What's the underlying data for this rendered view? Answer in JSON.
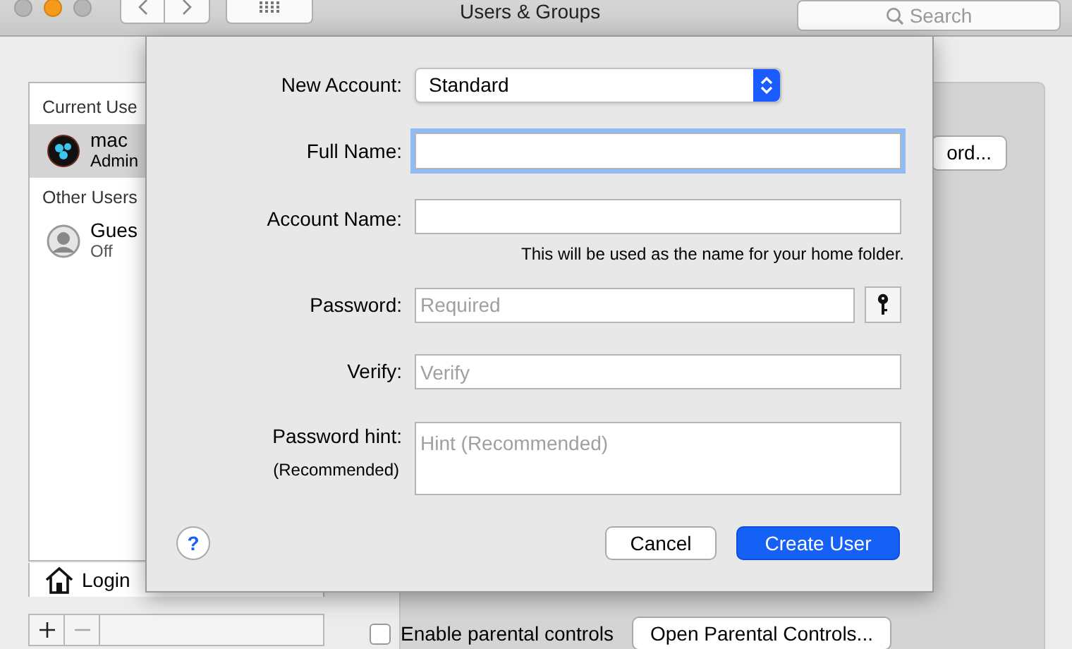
{
  "window": {
    "title": "Users & Groups",
    "search": {
      "placeholder": "Search"
    }
  },
  "sidebar": {
    "sections": [
      {
        "header": "Current Use",
        "users": [
          {
            "name": "mac",
            "role": "Admin",
            "selected": true,
            "kind": "admin"
          }
        ]
      },
      {
        "header": "Other Users",
        "users": [
          {
            "name": "Gues",
            "role": "Off",
            "selected": false,
            "kind": "guest"
          }
        ]
      }
    ],
    "login_options": "Login"
  },
  "detail": {
    "password_button": "ord...",
    "parental_controls": {
      "label": "Enable parental controls",
      "checked": false
    },
    "open_parental_button": "Open Parental Controls..."
  },
  "sheet": {
    "fields": [
      {
        "kind": "select",
        "label": "New Account:",
        "value": "Standard"
      },
      {
        "kind": "text",
        "label": "Full Name:",
        "focused": true
      },
      {
        "kind": "text",
        "label": "Account Name:",
        "focused": false,
        "note": "This will be used as the name for your home folder."
      },
      {
        "kind": "password",
        "label": "Password:",
        "placeholder": "Required"
      },
      {
        "kind": "text",
        "label": "Verify:",
        "placeholder": "Verify",
        "focused": false
      },
      {
        "kind": "textarea",
        "label": "Password hint:",
        "sublabel": "(Recommended)",
        "placeholder": "Hint (Recommended)"
      }
    ],
    "help": "?",
    "buttons": [
      {
        "label": "Cancel",
        "default": false
      },
      {
        "label": "Create User",
        "default": true
      }
    ]
  }
}
